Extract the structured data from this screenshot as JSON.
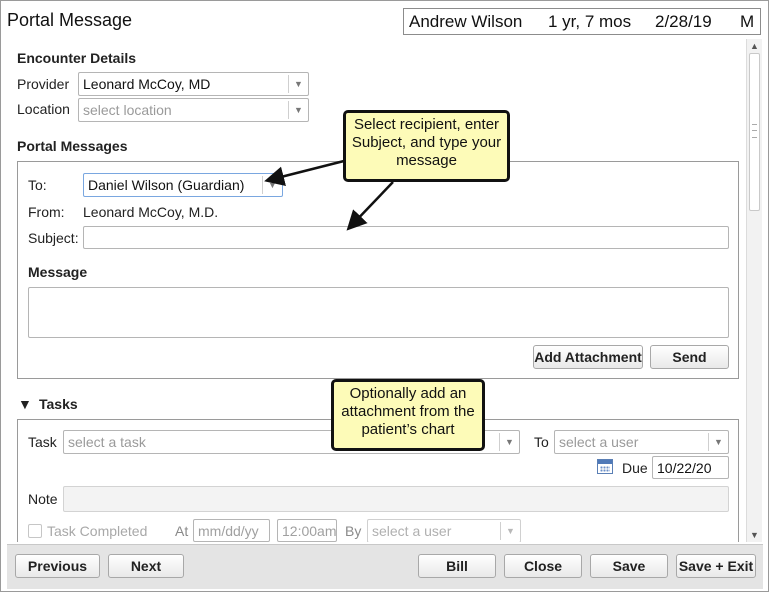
{
  "window": {
    "title": "Portal Message"
  },
  "patient": {
    "name": "Andrew Wilson",
    "age": "1 yr, 7 mos",
    "dob": "2/28/19",
    "sex": "M"
  },
  "encounter": {
    "heading": "Encounter Details",
    "provider_label": "Provider",
    "provider_value": "Leonard McCoy, MD",
    "location_label": "Location",
    "location_placeholder": "select location"
  },
  "portal": {
    "heading": "Portal Messages",
    "to_label": "To:",
    "to_value": "Daniel Wilson (Guardian)",
    "from_label": "From:",
    "from_value": "Leonard McCoy, M.D.",
    "subject_label": "Subject:",
    "subject_value": "",
    "message_label": "Message",
    "message_value": "",
    "add_attachment_label": "Add Attachment",
    "send_label": "Send"
  },
  "tasks": {
    "heading": "Tasks",
    "toggle_glyph": "▼",
    "task_label": "Task",
    "task_placeholder": "select a task",
    "to_label": "To",
    "to_placeholder": "select a user",
    "due_label": "Due",
    "due_value": "10/22/20",
    "note_label": "Note",
    "completed_label": "Task Completed",
    "at_label": "At",
    "date_placeholder": "mm/dd/yy",
    "time_placeholder": "12:00am",
    "by_label": "By",
    "by_placeholder": "select a user"
  },
  "callouts": {
    "recipient": "Select recipient, enter Subject, and type your message",
    "attachment": "Optionally add an attachment from the patient’s chart"
  },
  "footer": {
    "previous": "Previous",
    "next": "Next",
    "bill": "Bill",
    "close": "Close",
    "save": "Save",
    "save_exit": "Save + Exit"
  },
  "colors": {
    "callout_fill": "#fdfbb8",
    "footer_bg": "#e4e4e4",
    "focus_border": "#7aa7e0"
  },
  "icons": {
    "dropdown": "chevron-down-icon",
    "calendar": "calendar-icon",
    "collapse": "triangle-down-icon"
  }
}
